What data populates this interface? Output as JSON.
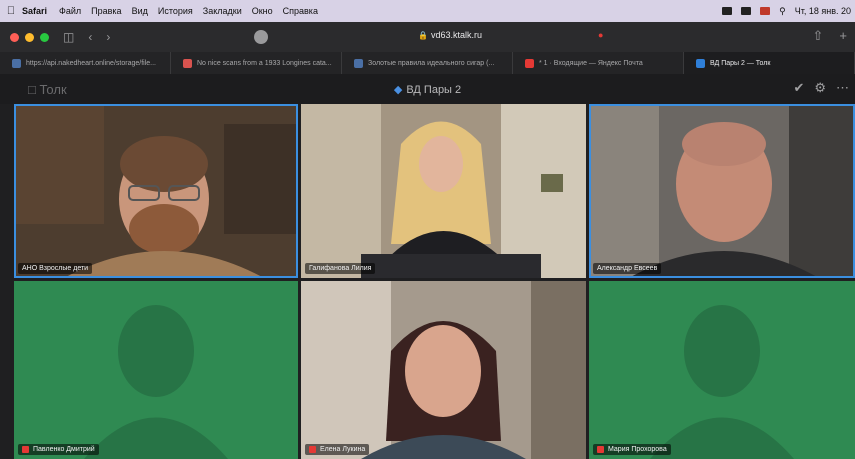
{
  "menubar": {
    "app": "Safari",
    "items": [
      "Файл",
      "Правка",
      "Вид",
      "История",
      "Закладки",
      "Окно",
      "Справка"
    ],
    "clock": "Чт, 18 янв. 20"
  },
  "browser": {
    "url": "vd63.ktalk.ru",
    "tabs": [
      {
        "label": "https://api.nakedheart.online/storage/file...",
        "color": "#4a6fa5"
      },
      {
        "label": "No nice scans from a 1933 Longines cata...",
        "color": "#d9534f"
      },
      {
        "label": "Золотые правила идеального сигар (...",
        "color": "#4a6fa5"
      },
      {
        "label": "* 1 · Входящие — Яндекс Почта",
        "color": "#e53935"
      },
      {
        "label": "ВД Пары 2 — Толк",
        "color": "#2f7fd8"
      }
    ]
  },
  "app": {
    "logo": "Толк",
    "room_title": "ВД Пары 2"
  },
  "participants": [
    {
      "name": "АНО Взрослые дети",
      "muted": false
    },
    {
      "name": "Галифанова Лилия",
      "muted": false
    },
    {
      "name": "Александр Евсеев",
      "muted": false
    },
    {
      "name": "Павленко Дмитрий",
      "muted": true
    },
    {
      "name": "Елена Лукина",
      "muted": true
    },
    {
      "name": "Мария Прохорова",
      "muted": true
    }
  ],
  "colors": {
    "selection": "#3b8fe0",
    "avatar_bg": "#2f8a52",
    "muted_mic": "#e53935"
  }
}
